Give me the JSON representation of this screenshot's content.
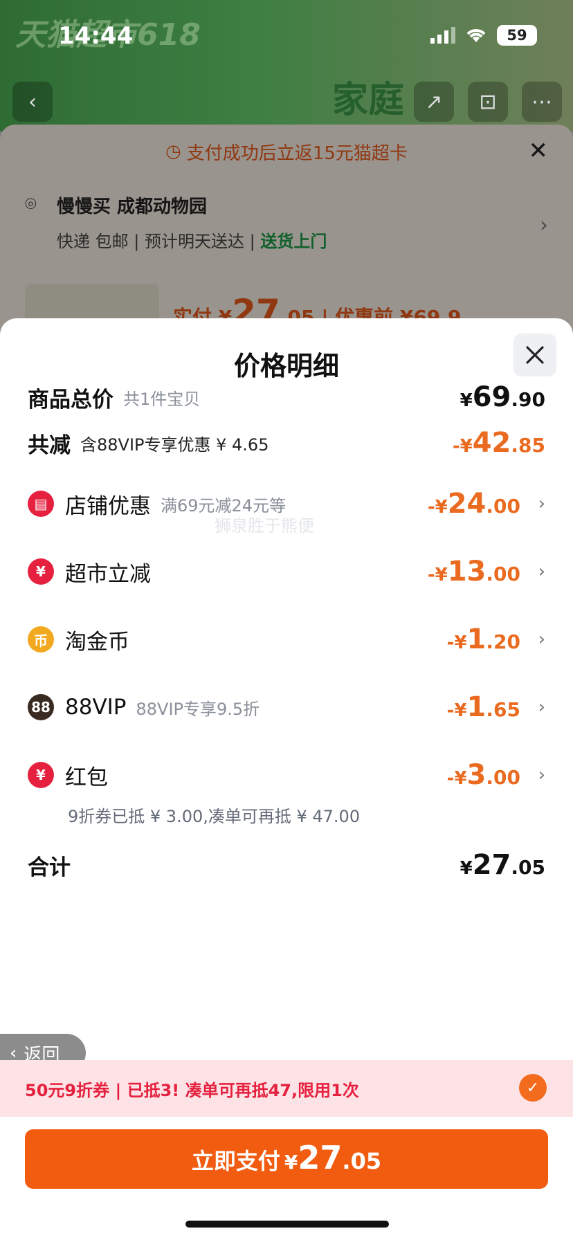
{
  "status_bar": {
    "time": "14:44",
    "battery": "59"
  },
  "background": {
    "banner_text": "天猫超市618",
    "product_text": "家庭"
  },
  "under_sheet": {
    "banner": "支付成功后立返15元猫超卡",
    "address_name": "慢慢买 成都动物园",
    "delivery": "快递 包邮 | 预计明天送达 |",
    "delivery_green": "送货上门",
    "pay_label": "实付 ¥",
    "pay_int": "27",
    "pay_dec": ".05",
    "pre_discount": "| 优惠前 ¥69.9"
  },
  "modal": {
    "title": "价格明细",
    "goods_total": {
      "label": "商品总价",
      "note": "共1件宝贝",
      "cur": "¥",
      "int": "69",
      "dec": ".90"
    },
    "total_discount": {
      "label": "共减",
      "note": "含88VIP专享优惠 ¥ 4.65",
      "cur": "-¥",
      "int": "42",
      "dec": ".85"
    },
    "items": [
      {
        "label": "店铺优惠",
        "note": "满69元减24元等",
        "icon": "store-icon",
        "color": "#e5213f",
        "cur": "-¥",
        "int": "24",
        "dec": ".00"
      },
      {
        "label": "超市立减",
        "note": "",
        "icon": "yuan-badge-icon",
        "color": "#e5213f",
        "cur": "-¥",
        "int": "13",
        "dec": ".00"
      },
      {
        "label": "淘金币",
        "note": "",
        "icon": "gold-coin-icon",
        "color": "#f2a91f",
        "cur": "-¥",
        "int": "1",
        "dec": ".20"
      },
      {
        "label": "88VIP",
        "note": "88VIP专享9.5折",
        "icon": "vip88-icon",
        "color": "#3a2b22",
        "cur": "-¥",
        "int": "1",
        "dec": ".65"
      },
      {
        "label": "红包",
        "note": "",
        "icon": "red-packet-icon",
        "color": "#e5213f",
        "cur": "-¥",
        "int": "3",
        "dec": ".00"
      }
    ],
    "red_packet_sub": "9折券已抵 ¥ 3.00,凑单可再抵 ¥ 47.00",
    "sum": {
      "label": "合计",
      "cur": "¥",
      "int": "27",
      "dec": ".05"
    },
    "watermark": "狮泉胜于熊便"
  },
  "back_label": "返回",
  "coupon_bar": "50元9折券 | 已抵3! 凑单可再抵47,限用1次",
  "pay_button": {
    "text": "立即支付",
    "cur": "¥",
    "int": "27",
    "dec": ".05"
  }
}
